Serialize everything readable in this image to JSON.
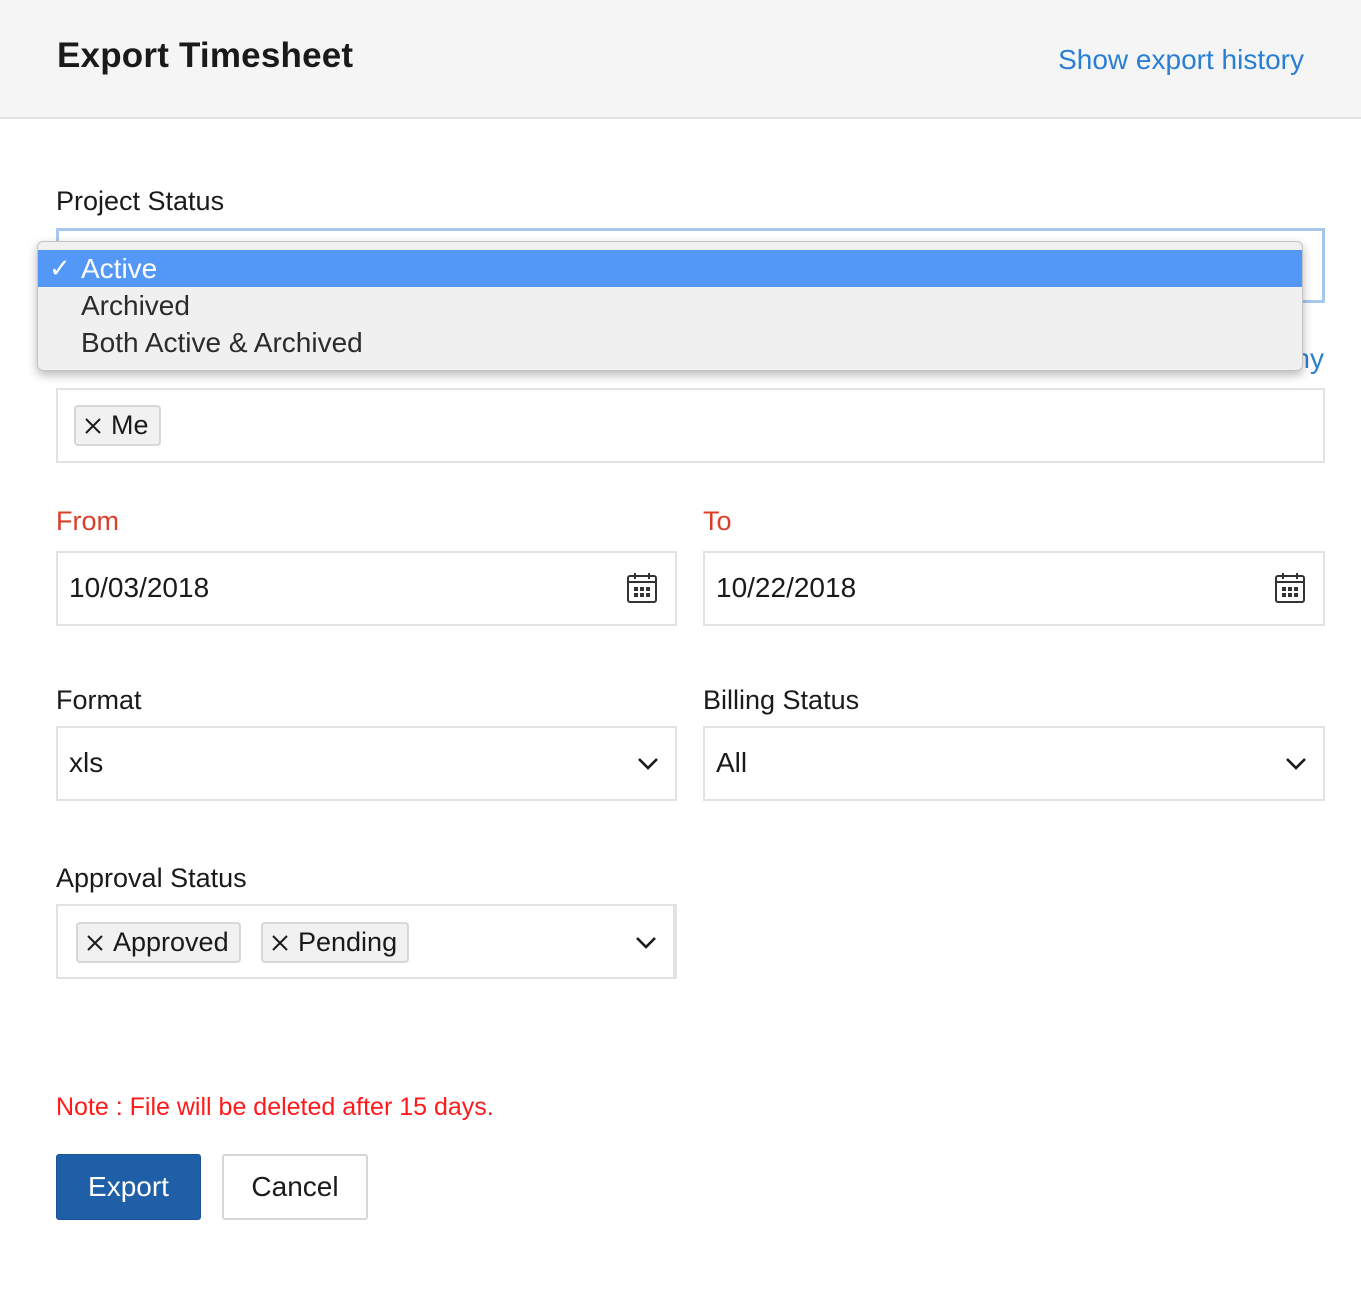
{
  "header": {
    "title": "Export Timesheet",
    "history_link": "Show export history"
  },
  "project_status": {
    "label": "Project Status",
    "options": [
      {
        "label": "Active",
        "selected": true
      },
      {
        "label": "Archived",
        "selected": false
      },
      {
        "label": "Both Active & Archived",
        "selected": false
      }
    ],
    "check_glyph": "✓"
  },
  "users": {
    "link_partial": "ny",
    "chips": [
      "Me"
    ]
  },
  "from": {
    "label": "From",
    "value": "10/03/2018"
  },
  "to": {
    "label": "To",
    "value": "10/22/2018"
  },
  "format": {
    "label": "Format",
    "value": "xls"
  },
  "billing_status": {
    "label": "Billing Status",
    "value": "All"
  },
  "approval_status": {
    "label": "Approval Status",
    "chips": [
      "Approved",
      "Pending"
    ]
  },
  "note": "Note : File will be deleted after 15 days.",
  "buttons": {
    "export": "Export",
    "cancel": "Cancel"
  },
  "colors": {
    "accent_link": "#2a7fd4",
    "required_label": "#d9402a",
    "note_text": "#ff1a1a",
    "primary_button": "#1f5fa8",
    "dropdown_selected": "#5498f7"
  }
}
